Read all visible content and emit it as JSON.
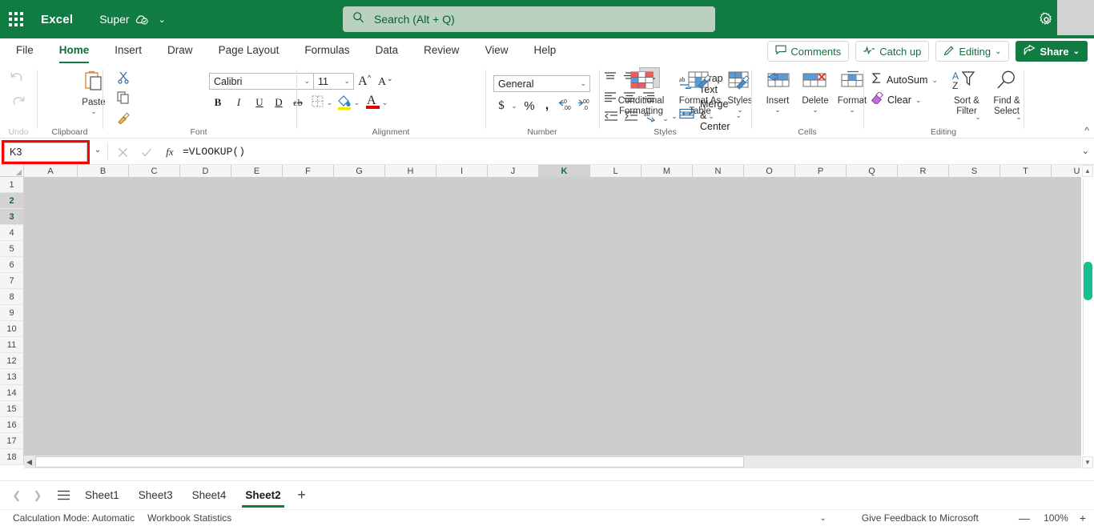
{
  "titlebar": {
    "app_name": "Excel",
    "doc_name": "Super",
    "waffle_icon": "app-launcher-icon",
    "cloud_icon": "cloud-saved-icon",
    "chevron_icon": "chevron-down-icon",
    "gear_icon": "settings-gear-icon",
    "brand_color": "#107C41"
  },
  "search": {
    "placeholder": "Search (Alt + Q)",
    "icon": "search-icon"
  },
  "ribbon_tabs": {
    "items": [
      {
        "label": "File",
        "active": false
      },
      {
        "label": "Home",
        "active": true
      },
      {
        "label": "Insert",
        "active": false
      },
      {
        "label": "Draw",
        "active": false
      },
      {
        "label": "Page Layout",
        "active": false
      },
      {
        "label": "Formulas",
        "active": false
      },
      {
        "label": "Data",
        "active": false
      },
      {
        "label": "Review",
        "active": false
      },
      {
        "label": "View",
        "active": false
      },
      {
        "label": "Help",
        "active": false
      }
    ],
    "right_buttons": [
      {
        "label": "Comments",
        "icon": "comment-bubble-icon"
      },
      {
        "label": "Catch up",
        "icon": "activity-line-icon"
      },
      {
        "label": "Editing",
        "icon": "pencil-icon",
        "chevron": true
      },
      {
        "label": "Share",
        "icon": "share-arrow-icon",
        "chevron": true
      }
    ]
  },
  "ribbon": {
    "undo": {
      "label": "Undo",
      "undo_icon": "undo-arrow-icon",
      "redo_icon": "redo-arrow-icon"
    },
    "clipboard": {
      "label": "Clipboard",
      "paste_label": "Paste",
      "paste_icon": "paste-clipboard-icon",
      "cut_icon": "scissors-icon",
      "copy_icon": "copy-pages-icon",
      "format_painter_icon": "format-painter-brush-icon"
    },
    "font": {
      "label": "Font",
      "font_name": "Calibri",
      "font_size": "11",
      "grow_font_icon": "increase-font-size-icon",
      "shrink_font_icon": "decrease-font-size-icon",
      "bold": "B",
      "italic": "I",
      "underline": "U",
      "double_underline": "D",
      "strikethrough": "ab",
      "borders_icon": "borders-icon",
      "fill_color_icon": "fill-color-icon",
      "font_color_icon": "font-color-icon"
    },
    "alignment": {
      "label": "Alignment",
      "wrap_text_label": "Wrap Text",
      "wrap_text_icon": "wrap-text-icon",
      "merge_center_label": "Merge & Center",
      "merge_center_icon": "merge-cells-icon",
      "align_top_icon": "align-top-icon",
      "align_middle_icon": "align-middle-icon",
      "align_bottom_icon": "align-bottom-icon",
      "align_left_icon": "align-left-icon",
      "align_center_icon": "align-center-icon",
      "align_right_icon": "align-right-icon",
      "decrease_indent_icon": "decrease-indent-icon",
      "increase_indent_icon": "increase-indent-icon",
      "orientation_icon": "text-orientation-icon"
    },
    "number": {
      "label": "Number",
      "format": "General",
      "currency_icon": "currency-dollar-icon",
      "percent_icon": "percent-icon",
      "comma_icon": "comma-style-icon",
      "increase_decimal_icon": "increase-decimal-icon",
      "decrease_decimal_icon": "decrease-decimal-icon"
    },
    "styles": {
      "label": "Styles",
      "conditional_formatting": "Conditional\nFormatting",
      "conditional_formatting_l1": "Conditional",
      "conditional_formatting_l2": "Formatting",
      "format_as_table_l1": "Format As",
      "format_as_table_l2": "Table",
      "styles_label": "Styles",
      "conditional_icon": "conditional-formatting-icon",
      "table_icon": "format-as-table-icon",
      "cellstyles_icon": "cell-styles-icon"
    },
    "cells": {
      "label": "Cells",
      "insert_label": "Insert",
      "delete_label": "Delete",
      "format_label": "Format",
      "insert_icon": "insert-cells-icon",
      "delete_icon": "delete-cells-icon",
      "format_icon": "format-cells-icon"
    },
    "editing": {
      "label": "Editing",
      "autosum_label": "AutoSum",
      "autosum_icon": "sigma-icon",
      "clear_label": "Clear",
      "clear_icon": "eraser-icon",
      "sort_filter_l1": "Sort &",
      "sort_filter_l2": "Filter",
      "sort_filter_icon": "sort-filter-icon",
      "find_select_l1": "Find &",
      "find_select_l2": "Select",
      "find_select_icon": "magnifier-icon"
    },
    "collapse_icon": "collapse-ribbon-chevron-icon"
  },
  "formula_bar": {
    "name_box_value": "K3",
    "name_box_highlight_color": "#FF0000",
    "name_box_chevron_icon": "chevron-down-icon",
    "cancel_icon": "cancel-x-icon",
    "enter_icon": "confirm-check-icon",
    "insert_function_icon": "fx-icon",
    "insert_function_label": "fx",
    "formula_value": "=VLOOKUP()",
    "expand_icon": "expand-formula-bar-icon"
  },
  "grid": {
    "columns": [
      "A",
      "B",
      "C",
      "D",
      "E",
      "F",
      "G",
      "H",
      "I",
      "J",
      "K",
      "L",
      "M",
      "N",
      "O",
      "P",
      "Q",
      "R",
      "S",
      "T",
      "U"
    ],
    "selected_column": "K",
    "rows": [
      "1",
      "2",
      "3",
      "4",
      "5",
      "6",
      "7",
      "8",
      "9",
      "10",
      "11",
      "12",
      "13",
      "14",
      "15",
      "16",
      "17",
      "18"
    ],
    "selected_rows": [
      "2",
      "3"
    ],
    "select_all_icon": "select-all-corner-icon",
    "scroll_up_icon": "scroll-up-arrow-icon",
    "scroll_down_icon": "scroll-down-arrow-icon",
    "scroll_left_icon": "scroll-left-arrow-icon",
    "scroll_right_icon": "scroll-right-arrow-icon",
    "vertical_thumb_color": "#13C08F"
  },
  "sheet_bar": {
    "prev_icon": "previous-sheet-arrow-icon",
    "next_icon": "next-sheet-arrow-icon",
    "all_sheets_icon": "all-sheets-hamburger-icon",
    "tabs": [
      {
        "label": "Sheet1",
        "active": false
      },
      {
        "label": "Sheet3",
        "active": false
      },
      {
        "label": "Sheet4",
        "active": false
      },
      {
        "label": "Sheet2",
        "active": true
      }
    ],
    "add_sheet_label": "+",
    "add_sheet_icon": "add-sheet-plus-icon"
  },
  "status_bar": {
    "calculation_mode": "Calculation Mode: Automatic",
    "workbook_statistics": "Workbook Statistics",
    "options_chevron_icon": "chevron-down-icon",
    "feedback": "Give Feedback to Microsoft",
    "zoom_out_label": "—",
    "zoom_out_icon": "zoom-out-minus-icon",
    "zoom_value": "100%",
    "zoom_in_label": "+",
    "zoom_in_icon": "zoom-in-plus-icon"
  }
}
